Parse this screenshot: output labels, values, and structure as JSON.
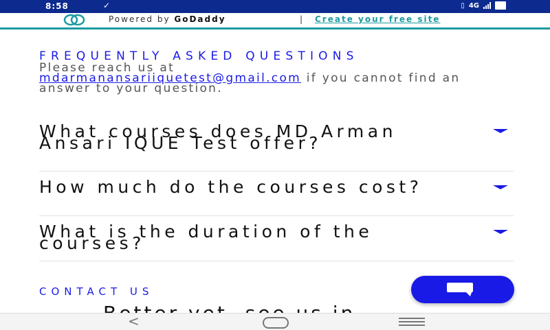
{
  "status_bar": {
    "time": "8:58",
    "network": "4G",
    "icons": [
      "check-icon",
      "vibrate-icon",
      "signal-icon",
      "battery-icon"
    ]
  },
  "banner": {
    "powered_prefix": "Powered by ",
    "brand": "GoDaddy",
    "separator": "|",
    "cta": "Create your free site"
  },
  "faq": {
    "title": "FREQUENTLY ASKED QUESTIONS",
    "intro_before": "Please reach us at",
    "email": "mdarmanansariiquetest@gmail.com",
    "intro_after": " if you cannot find an answer to your question.",
    "items": [
      {
        "question": "What courses does MD Arman Ansari IQUE Test offer?"
      },
      {
        "question": "How much do the courses cost?"
      },
      {
        "question": "What is the duration of the courses?"
      }
    ]
  },
  "contact": {
    "title": "CONTACT US",
    "subtitle": "Better yet, see us in"
  },
  "accent_color": "#1a1ae6",
  "banner_accent_color": "#1a9aa0"
}
